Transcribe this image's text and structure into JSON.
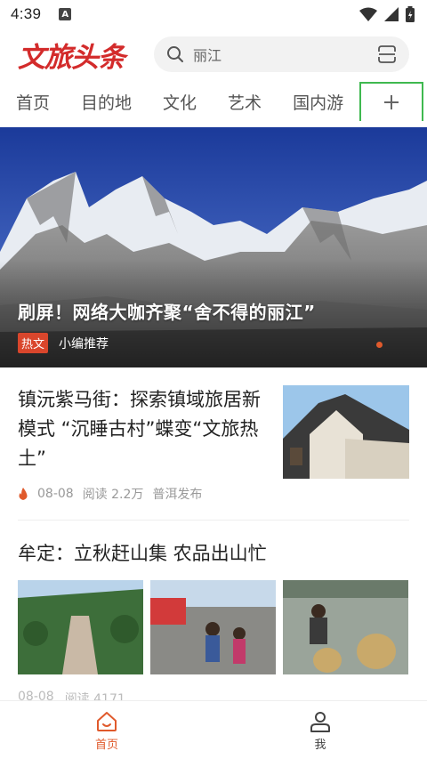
{
  "status_bar": {
    "time": "4:39",
    "notification_icon": "A"
  },
  "header": {
    "logo": "文旅头条",
    "search_value": "丽江",
    "colors": {
      "brand": "#d32b2b",
      "accent": "#e05a2c"
    }
  },
  "tabs": [
    "首页",
    "目的地",
    "文化",
    "艺术",
    "国内游"
  ],
  "plus_label": "+",
  "hero": {
    "title": "刷屏！网络大咖齐聚“舍不得的丽江”",
    "badge": "热文",
    "source": "小编推荐"
  },
  "article1": {
    "title": "镇沅紫马街：探索镇域旅居新模式 “沉睡古村”蝶变“文旅热土”",
    "date": "08-08",
    "reads": "阅读 2.2万",
    "source": "普洱发布"
  },
  "article2": {
    "title": "牟定：立秋赶山集 农品出山忙",
    "date": "08-08",
    "reads": "阅读 4171"
  },
  "bottom_nav": {
    "home": "首页",
    "me": "我"
  }
}
